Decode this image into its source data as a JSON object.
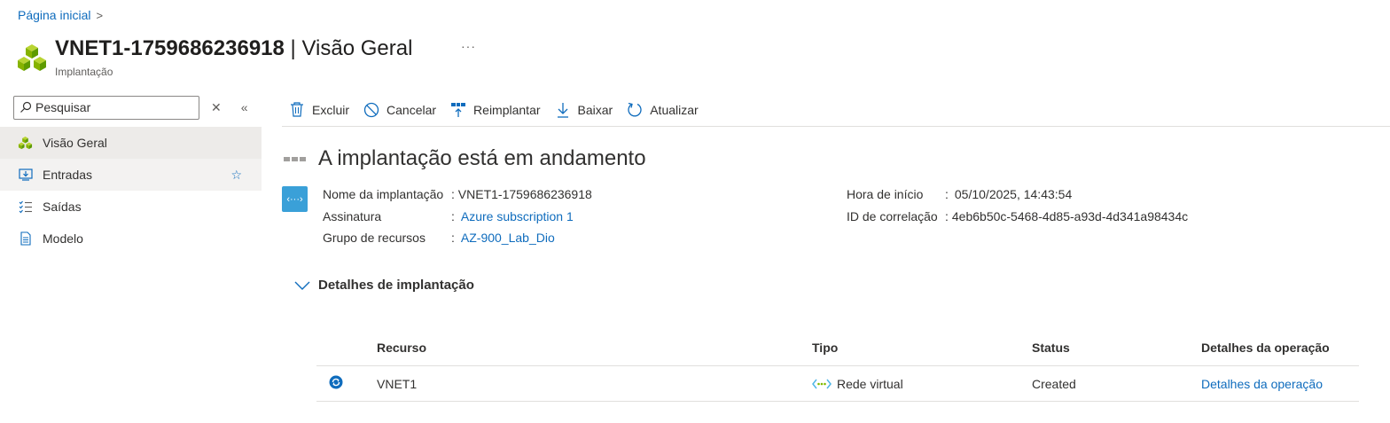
{
  "breadcrumb": {
    "home": "Página inicial"
  },
  "header": {
    "title_name": "VNET1-1759686236918",
    "title_section": "| Visão Geral",
    "subtitle": "Implantação",
    "more": "···"
  },
  "sidebar": {
    "search_placeholder": "Pesquisar",
    "items": [
      {
        "label": "Visão Geral",
        "icon": "cubes-icon"
      },
      {
        "label": "Entradas",
        "icon": "inputs-icon"
      },
      {
        "label": "Saídas",
        "icon": "outputs-icon"
      },
      {
        "label": "Modelo",
        "icon": "template-icon"
      }
    ]
  },
  "toolbar": {
    "delete": "Excluir",
    "cancel": "Cancelar",
    "redeploy": "Reimplantar",
    "download": "Baixar",
    "refresh": "Atualizar"
  },
  "status": {
    "text": "A implantação está em andamento"
  },
  "info": {
    "deployment_name_label": "Nome da implantação",
    "deployment_name_value": ": VNET1-1759686236918",
    "subscription_label": "Assinatura",
    "subscription_value": "Azure subscription 1",
    "resource_group_label": "Grupo de recursos",
    "resource_group_value": "AZ-900_Lab_Dio",
    "start_time_label": "Hora de início",
    "start_time_value": "05/10/2025, 14:43:54",
    "correlation_label": "ID de correlação",
    "correlation_value": "4eb6b50c-5468-4d85-a93d-4d341a98434c",
    "colon": ":"
  },
  "details": {
    "section_title": "Detalhes de implantação",
    "columns": [
      "Recurso",
      "Tipo",
      "Status",
      "Detalhes da operação"
    ],
    "rows": [
      {
        "resource": "VNET1",
        "type": "Rede virtual",
        "status": "Created",
        "ops": "Detalhes da operação"
      }
    ]
  },
  "colors": {
    "accent": "#0f6cbd",
    "deploy_icon": "#3aa0d8"
  }
}
